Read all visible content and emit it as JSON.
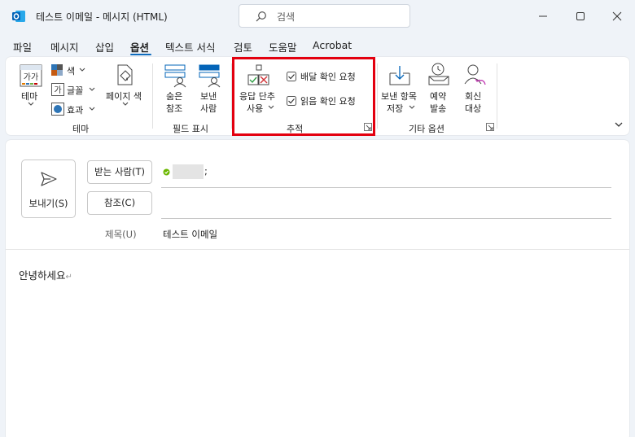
{
  "window": {
    "title": "테스트 이메일 - 메시지 (HTML)",
    "search_placeholder": "검색",
    "icons": [
      "outlook-app-icon",
      "search-icon",
      "minimize-icon",
      "maximize-icon",
      "close-icon"
    ]
  },
  "menu": {
    "tabs": [
      "파일",
      "메시지",
      "삽입",
      "옵션",
      "텍스트 서식",
      "검토",
      "도움말",
      "Acrobat"
    ],
    "active_tab": "옵션"
  },
  "ribbon": {
    "theme_group": {
      "theme_label": "테마",
      "theme_icon_text": "가가",
      "colors_label": "색",
      "fonts_label": "글꼴",
      "fonts_icon_text": "가",
      "effects_label": "효과",
      "page_color_label": "페이지 색",
      "group_label": "테마"
    },
    "fields_group": {
      "bcc_label_1": "숨은",
      "bcc_label_2": "참조",
      "from_label_1": "보낸",
      "from_label_2": "사람",
      "group_label": "필드 표시"
    },
    "tracking_group": {
      "voting_label_1": "응답 단추",
      "voting_label_2": "사용",
      "delivery_receipt_label": "배달 확인 요청",
      "delivery_receipt_checked": true,
      "read_receipt_label": "읽음 확인 요청",
      "read_receipt_checked": true,
      "group_label": "추적",
      "highlight_color": "#e3000f"
    },
    "more_options_group": {
      "save_sent_label_1": "보낸 항목",
      "save_sent_label_2": "저장",
      "delay_label_1": "예약",
      "delay_label_2": "발송",
      "reply_to_label_1": "회신",
      "reply_to_label_2": "대상",
      "group_label": "기타 옵션"
    }
  },
  "compose": {
    "send_label": "보내기(S)",
    "to_button": "받는 사람(T)",
    "to_suffix": ";",
    "cc_button": "참조(C)",
    "subject_label": "제목(U)",
    "subject_value": "테스트 이메일",
    "body_text": "안녕하세요"
  },
  "colors": {
    "accent": "#0f6cbd",
    "outlook_blue": "#0364b8",
    "presence_green": "#6bb700"
  }
}
